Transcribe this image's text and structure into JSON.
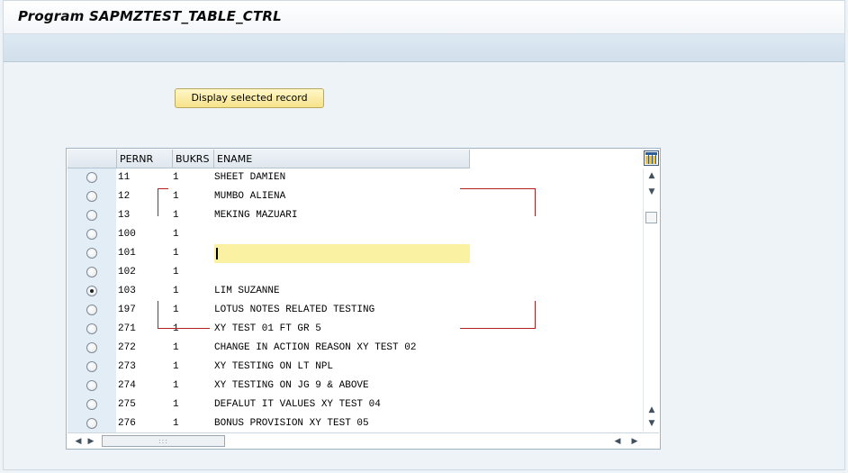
{
  "window": {
    "title": "Program SAPMZTEST_TABLE_CTRL"
  },
  "toolbar": {
    "display_button_label": "Display selected record"
  },
  "table": {
    "columns": [
      "PERNR",
      "BUKRS",
      "ENAME"
    ],
    "rows": [
      {
        "pernr": "11",
        "bukrs": "1",
        "ename": "SHEET DAMIEN",
        "selected": false
      },
      {
        "pernr": "12",
        "bukrs": "1",
        "ename": "MUMBO ALIENA",
        "selected": false
      },
      {
        "pernr": "13",
        "bukrs": "1",
        "ename": "MEKING MAZUARI",
        "selected": false
      },
      {
        "pernr": "100",
        "bukrs": "1",
        "ename": "",
        "selected": false
      },
      {
        "pernr": "101",
        "bukrs": "1",
        "ename": "",
        "selected": false,
        "editing": true
      },
      {
        "pernr": "102",
        "bukrs": "1",
        "ename": "",
        "selected": false
      },
      {
        "pernr": "103",
        "bukrs": "1",
        "ename": "LIM SUZANNE",
        "selected": true
      },
      {
        "pernr": "197",
        "bukrs": "1",
        "ename": "LOTUS NOTES RELATED TESTING",
        "selected": false
      },
      {
        "pernr": "271",
        "bukrs": "1",
        "ename": "XY TEST 01 FT GR 5",
        "selected": false
      },
      {
        "pernr": "272",
        "bukrs": "1",
        "ename": "CHANGE IN ACTION REASON XY TEST 02",
        "selected": false
      },
      {
        "pernr": "273",
        "bukrs": "1",
        "ename": "XY TESTING ON LT NPL",
        "selected": false
      },
      {
        "pernr": "274",
        "bukrs": "1",
        "ename": "XY TESTING ON JG 9 & ABOVE",
        "selected": false
      },
      {
        "pernr": "275",
        "bukrs": "1",
        "ename": "DEFALUT IT VALUES XY TEST 04",
        "selected": false
      },
      {
        "pernr": "276",
        "bukrs": "1",
        "ename": "BONUS PROVISION XY TEST 05",
        "selected": false
      }
    ]
  },
  "icons": {
    "config": "table-settings-icon",
    "scroll_up": "scroll-up-icon",
    "scroll_down": "scroll-down-icon",
    "scroll_left": "scroll-left-icon",
    "scroll_right": "scroll-right-icon"
  },
  "colors": {
    "button_fill": "#f6e38a",
    "edit_cell": "#fbf1a2",
    "annotation_line": "#b21f1f"
  }
}
